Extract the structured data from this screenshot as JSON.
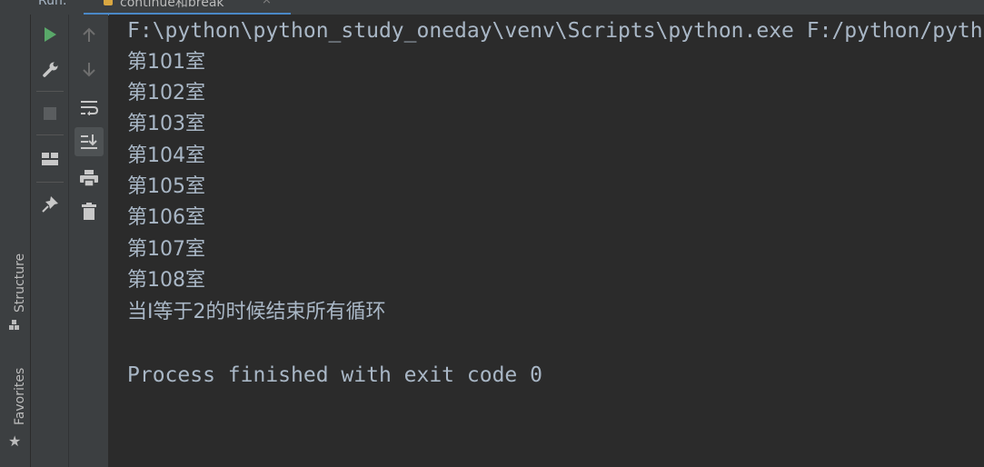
{
  "run_header": {
    "run_label": "Run:",
    "tab_title": "continue和break",
    "tab_close": "×"
  },
  "left_stripe": {
    "structure_label": "Structure",
    "favorites_label": "Favorites"
  },
  "toolbar": {
    "left_icons": [
      "run-icon",
      "wrench-icon",
      "stop-icon",
      "layout-icon",
      "pin-icon"
    ],
    "right_icons": [
      "up-arrow-icon",
      "down-arrow-icon",
      "soft-wrap-icon",
      "scroll-to-end-icon",
      "print-icon",
      "trash-icon"
    ]
  },
  "console": {
    "command_line": "F:\\python\\python_study_oneday\\venv\\Scripts\\python.exe F:/python/pyth",
    "output_lines": [
      "第101室",
      "第102室",
      "第103室",
      "第104室",
      "第105室",
      "第106室",
      "第107室",
      "第108室",
      "当I等于2的时候结束所有循环"
    ],
    "blank_line": "",
    "exit_message": "Process finished with exit code 0"
  },
  "colors": {
    "console_bg": "#2b2b2b",
    "panel_bg": "#3c3f41",
    "text": "#a9b7c6",
    "run_green": "#59a869",
    "tab_underline": "#4a88c7"
  }
}
